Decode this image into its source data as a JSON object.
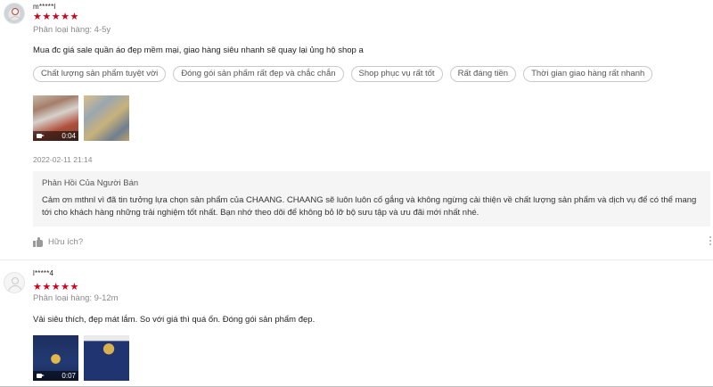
{
  "reviews": [
    {
      "username": "m*****l",
      "stars": "★★★★★",
      "variant": "Phân loại hàng: 4-5y",
      "comment": "Mua đc giá sale quần áo đẹp mềm mại, giao hàng siêu nhanh sẽ quay lại ủng hộ shop a",
      "tags": [
        "Chất lượng sản phẩm tuyệt vời",
        "Đóng gói sản phẩm rất đẹp và chắc chắn",
        "Shop phục vụ rất tốt",
        "Rất đáng tiền",
        "Thời gian giao hàng rất nhanh"
      ],
      "video_duration": "0:04",
      "datetime": "2022-02-11 21:14",
      "seller_reply": {
        "title": "Phản Hồi Của Người Bán",
        "text": "Cảm ơn  mthnl  vì đã tin tưởng lựa chọn sản phẩm của CHAANG. CHAANG sẽ luôn luôn cố gắng và không ngừng cải thiện về chất lượng sản phẩm và dịch vụ để có thể mang tới cho khách hàng những trải nghiệm tốt nhất. Bạn nhớ theo dõi để không bỏ lỡ bộ sưu tập và ưu đãi mới nhất nhé."
      },
      "helpful_label": "Hữu ích?"
    },
    {
      "username": "l*****4",
      "stars": "★★★★★",
      "variant": "Phân loại hàng: 9-12m",
      "comment": "Vải siêu thích, đẹp mát lắm. So với giá thì quá ổn. Đóng gói sản phẩm đẹp.",
      "video_duration": "0:07"
    }
  ],
  "icons": {
    "rating": "star-icon",
    "video": "video-camera-icon",
    "helpful": "thumbs-up-icon",
    "more": "more-vertical-icon",
    "avatar": "user-avatar-icon"
  },
  "colors": {
    "star": "#d0011b",
    "muted": "#8a8a8a",
    "reply_bg": "#f5f5f5"
  }
}
